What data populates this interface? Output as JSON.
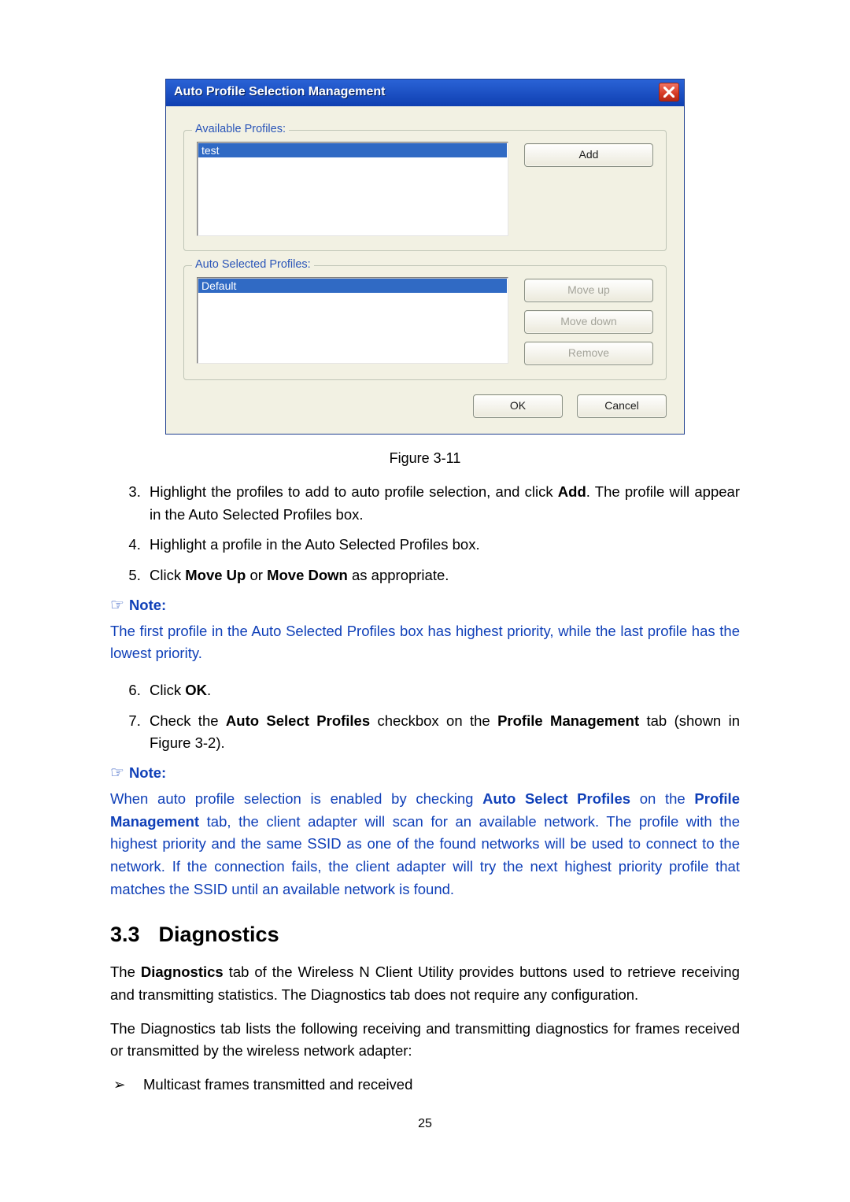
{
  "dialog": {
    "title": "Auto Profile Selection Management",
    "available": {
      "legend": "Available Profiles:",
      "item": "test",
      "add_label": "Add"
    },
    "selected": {
      "legend": "Auto Selected Profiles:",
      "item": "Default",
      "moveup_label": "Move up",
      "movedown_label": "Move down",
      "remove_label": "Remove"
    },
    "ok_label": "OK",
    "cancel_label": "Cancel"
  },
  "figure_caption": "Figure 3-11",
  "steps_a": {
    "s3_a": "Highlight the profiles to add to auto profile selection, and click ",
    "s3_bold": "Add",
    "s3_b": ". The profile will appear in the Auto Selected Profiles box.",
    "s4": "Highlight a profile in the Auto Selected Profiles box.",
    "s5_a": "Click ",
    "s5_bold1": "Move Up",
    "s5_mid": " or ",
    "s5_bold2": "Move Down",
    "s5_b": " as appropriate."
  },
  "note1": {
    "label": "Note:",
    "body": "The first profile in the Auto Selected Profiles box has highest priority, while the last profile has the lowest priority."
  },
  "steps_b": {
    "s6_a": "Click ",
    "s6_bold": "OK",
    "s6_b": ".",
    "s7_a": "Check the ",
    "s7_bold1": "Auto Select Profiles",
    "s7_mid": " checkbox on the ",
    "s7_bold2": "Profile Management",
    "s7_b": " tab (shown in Figure 3-2)."
  },
  "note2": {
    "label": "Note:",
    "a": "When auto profile selection is enabled by checking ",
    "bold1": "Auto Select Profiles",
    "mid1": " on the ",
    "bold2": "Profile Management",
    "b": " tab, the client adapter will scan for an available network. The profile with the highest priority and the same SSID as one of the found networks will be used to connect to the network. If the connection fails, the client adapter will try the next highest priority profile that matches the SSID until an available network is found."
  },
  "section": {
    "num": "3.3",
    "title": "Diagnostics"
  },
  "diag": {
    "p1_a": "The ",
    "p1_bold": "Diagnostics",
    "p1_b": " tab of the Wireless N Client Utility provides buttons used to retrieve receiving and transmitting statistics. The Diagnostics tab does not require any configuration.",
    "p2": "The Diagnostics tab lists the following receiving and transmitting diagnostics for frames received or transmitted by the wireless network adapter:",
    "b1": "Multicast frames transmitted and received"
  },
  "page_num": "25",
  "glyphs": {
    "hand": "☞",
    "arrow": "➢"
  }
}
